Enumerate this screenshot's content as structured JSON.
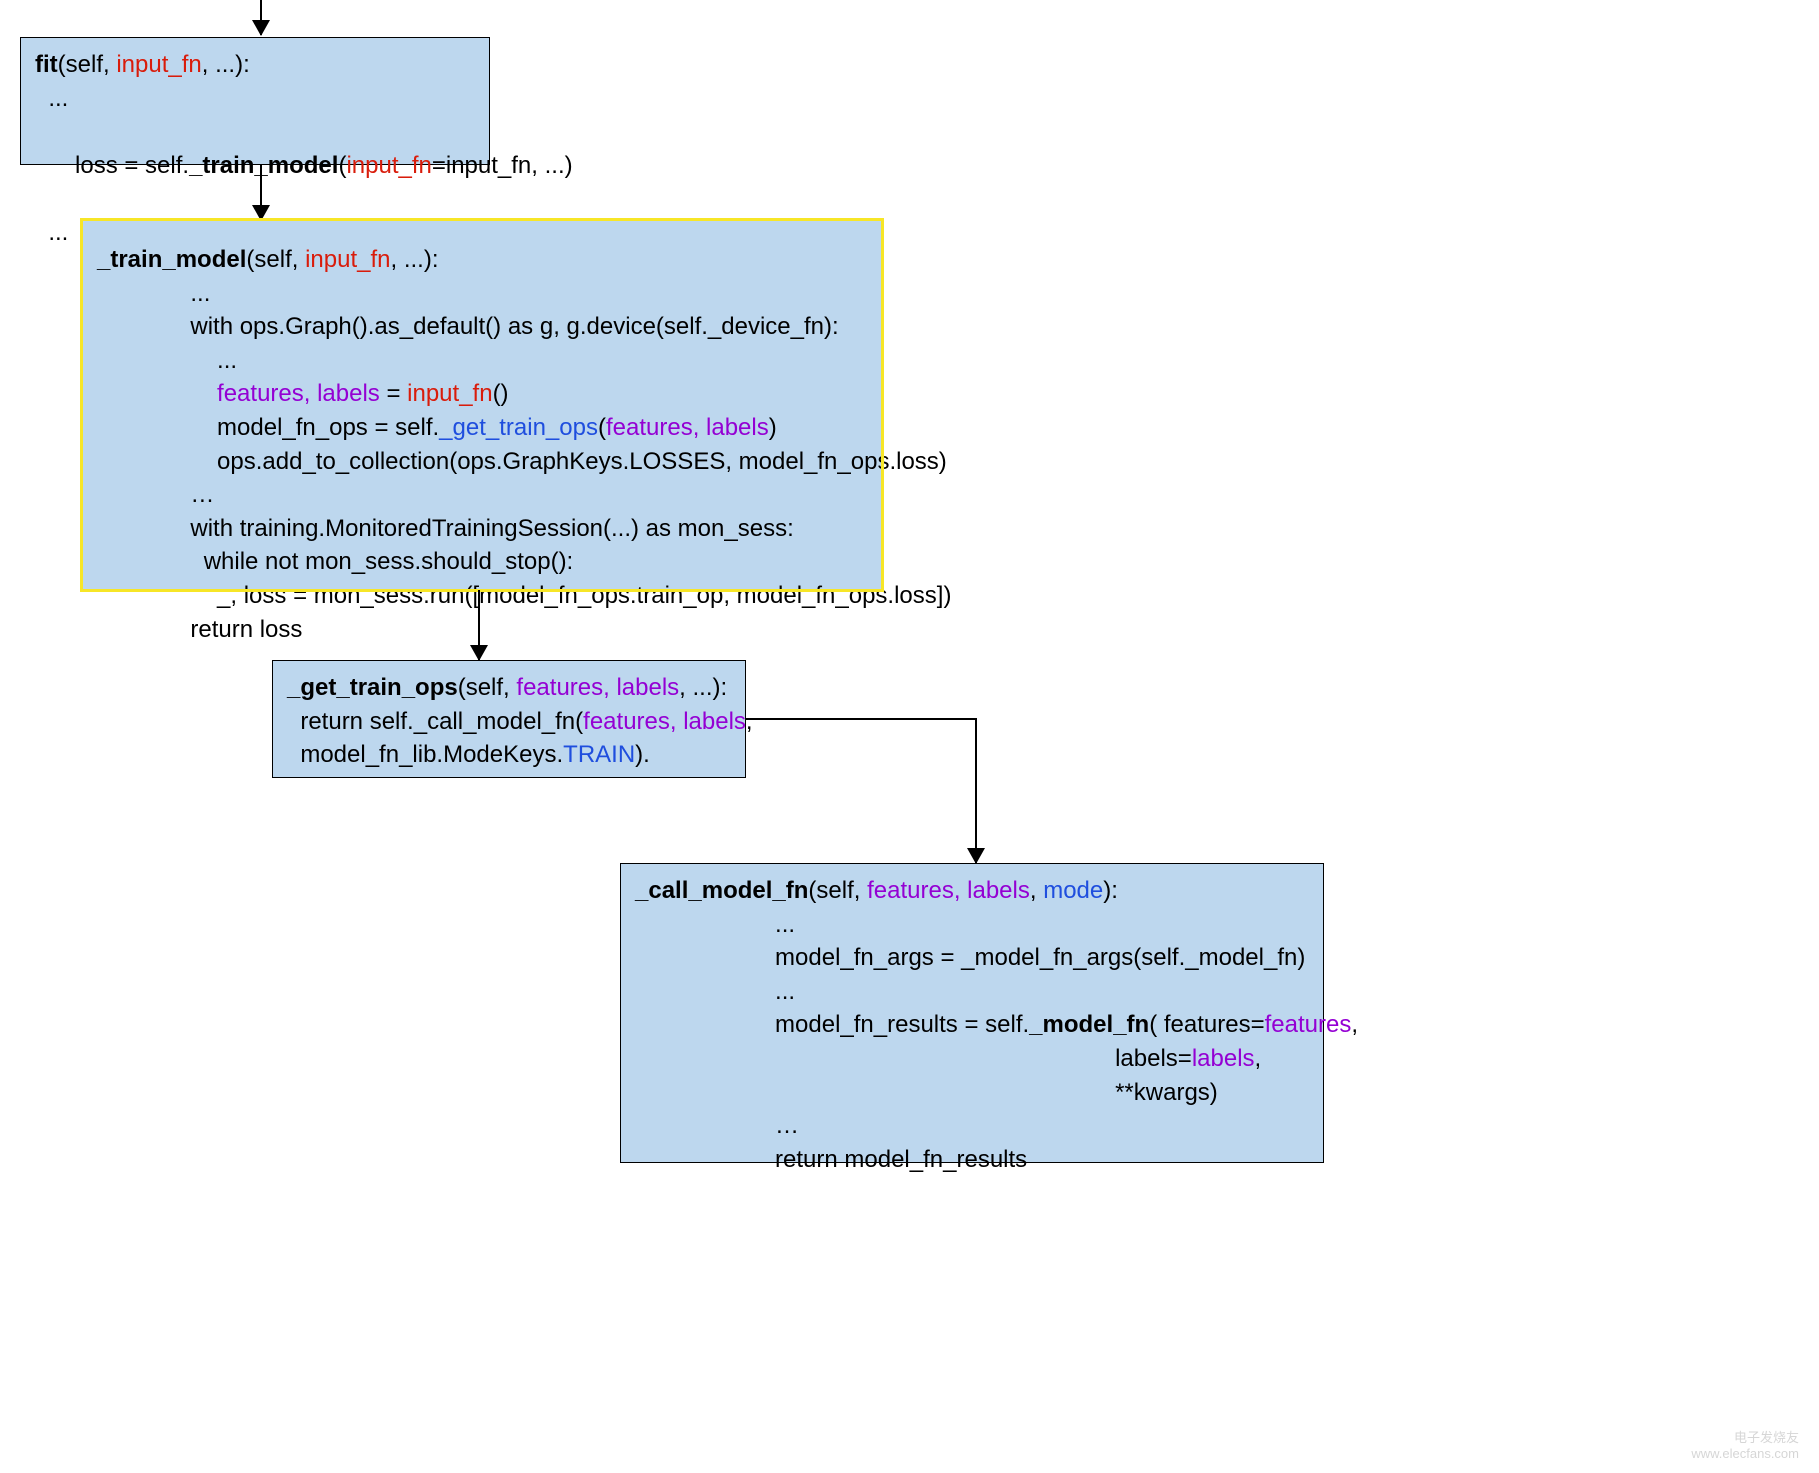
{
  "box1": {
    "sig_fn": "fit",
    "sig_self": "(self, ",
    "sig_input_fn": "input_fn",
    "sig_rest": ", ...):",
    "l1": "  ...",
    "l2a": "  loss = self.",
    "l2b": "_train_model",
    "l2c": "(",
    "l2d": "input_fn",
    "l2e": "=input_fn, ...)",
    "l3": "  ..."
  },
  "box2": {
    "sig_fn": "_train_model",
    "sig_self": "(self, ",
    "sig_input_fn": "input_fn",
    "sig_rest": ", ...):",
    "indent1": "              ",
    "l1": "...",
    "l2": "with ops.Graph().as_default() as g, g.device(self._device_fn):",
    "indent2": "                  ",
    "l3": "...",
    "l4pre": "",
    "l4a": "features, labels",
    "l4b": " = ",
    "l4c": "input_fn",
    "l4d": "()",
    "l5a": "model_fn_ops = self.",
    "l5b": "_get_train_ops",
    "l5c": "(",
    "l5d": "features, labels",
    "l5e": ")",
    "l6": "ops.add_to_collection(ops.GraphKeys.LOSSES, model_fn_ops.loss)",
    "l7": "…",
    "l8": "with training.MonitoredTrainingSession(...) as mon_sess:",
    "l9": "  while not mon_sess.should_stop():",
    "l10": "    _, loss = mon_sess.run([model_fn_ops.train_op, model_fn_ops.loss])",
    "l11": "return loss"
  },
  "box3": {
    "sig_fn": "_get_train_ops",
    "sig_self": "(self, ",
    "sig_fl": "features, labels",
    "sig_rest": ", ...):",
    "l1a": "  return self._call_model_fn(",
    "l1b": "features, labels",
    "l1c": ",",
    "l2a": "  model_fn_lib.ModeKeys.",
    "l2b": "TRAIN",
    "l2c": ")."
  },
  "box4": {
    "sig_fn": "_call_model_fn",
    "sig_self": "(self, ",
    "sig_fl": "features, labels",
    "sig_comma": ", ",
    "sig_mode": "mode",
    "sig_rest": "):",
    "indent1": "                     ",
    "l1": "...",
    "l2": "model_fn_args = _model_fn_args(self._model_fn)",
    "l3": "...",
    "l4a": "model_fn_results = self.",
    "l4b": "_model_fn",
    "l4c": "( features=",
    "l4d": "features",
    "l4e": ",",
    "indentArgs": "                                                                        ",
    "l5a": "labels=",
    "l5b": "labels",
    "l5c": ",",
    "l6": "**kwargs)",
    "l7": "…",
    "l8": "return model_fn_results"
  },
  "watermark": {
    "line1": "电子发烧友",
    "line2": "www.elecfans.com"
  }
}
